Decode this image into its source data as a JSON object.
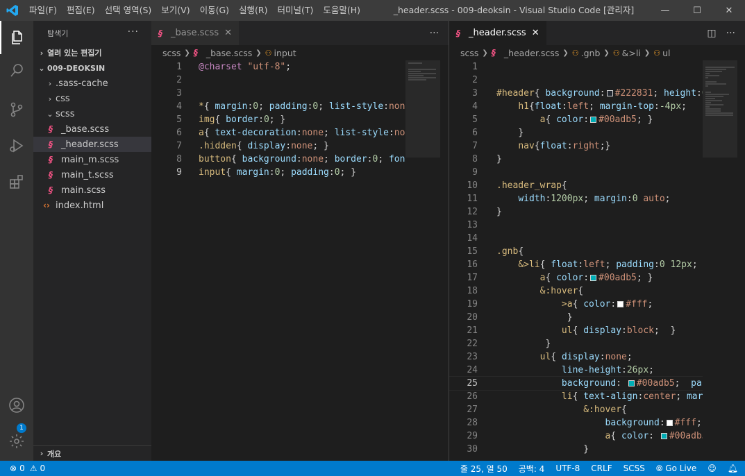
{
  "titlebar": {
    "menu": [
      "파일(F)",
      "편집(E)",
      "선택 영역(S)",
      "보기(V)",
      "이동(G)",
      "실행(R)",
      "터미널(T)",
      "도움말(H)"
    ],
    "title": "_header.scss - 009-deoksin - Visual Studio Code [관리자]",
    "minimize": "—",
    "maximize": "☐",
    "close": "✕"
  },
  "explorer": {
    "header": "탐색기",
    "more": "···",
    "open_editors": "열려 있는 편집기",
    "project": "009-DEOKSIN",
    "tree": [
      {
        "label": ".sass-cache",
        "type": "folder",
        "chev": "›"
      },
      {
        "label": "css",
        "type": "folder",
        "chev": "›"
      },
      {
        "label": "scss",
        "type": "folder",
        "chev": "⌄"
      },
      {
        "label": "_base.scss",
        "type": "sass"
      },
      {
        "label": "_header.scss",
        "type": "sass",
        "selected": true
      },
      {
        "label": "main_m.scss",
        "type": "sass"
      },
      {
        "label": "main_t.scss",
        "type": "sass"
      },
      {
        "label": "main.scss",
        "type": "sass"
      },
      {
        "label": "index.html",
        "type": "html"
      }
    ],
    "outline": "개요"
  },
  "left_editor": {
    "tab": "_base.scss",
    "tab_close": "✕",
    "more": "···",
    "breadcrumb": [
      "scss",
      "_base.scss",
      "input"
    ]
  },
  "right_editor": {
    "tab": "_header.scss",
    "tab_close": "✕",
    "more": "···",
    "breadcrumb": [
      "scss",
      "_header.scss",
      ".gnb",
      "&>li",
      "ul"
    ]
  },
  "statusbar": {
    "errors": "0",
    "warnings": "0",
    "position": "줄 25, 열 50",
    "spaces": "공백: 4",
    "encoding": "UTF-8",
    "eol": "CRLF",
    "language": "SCSS",
    "golive": "Go Live",
    "settings_badge": "1"
  },
  "colors": {
    "accent": "#007acc",
    "activity_bar": "#333333",
    "sidebar": "#252526",
    "editor": "#1e1e1e"
  }
}
